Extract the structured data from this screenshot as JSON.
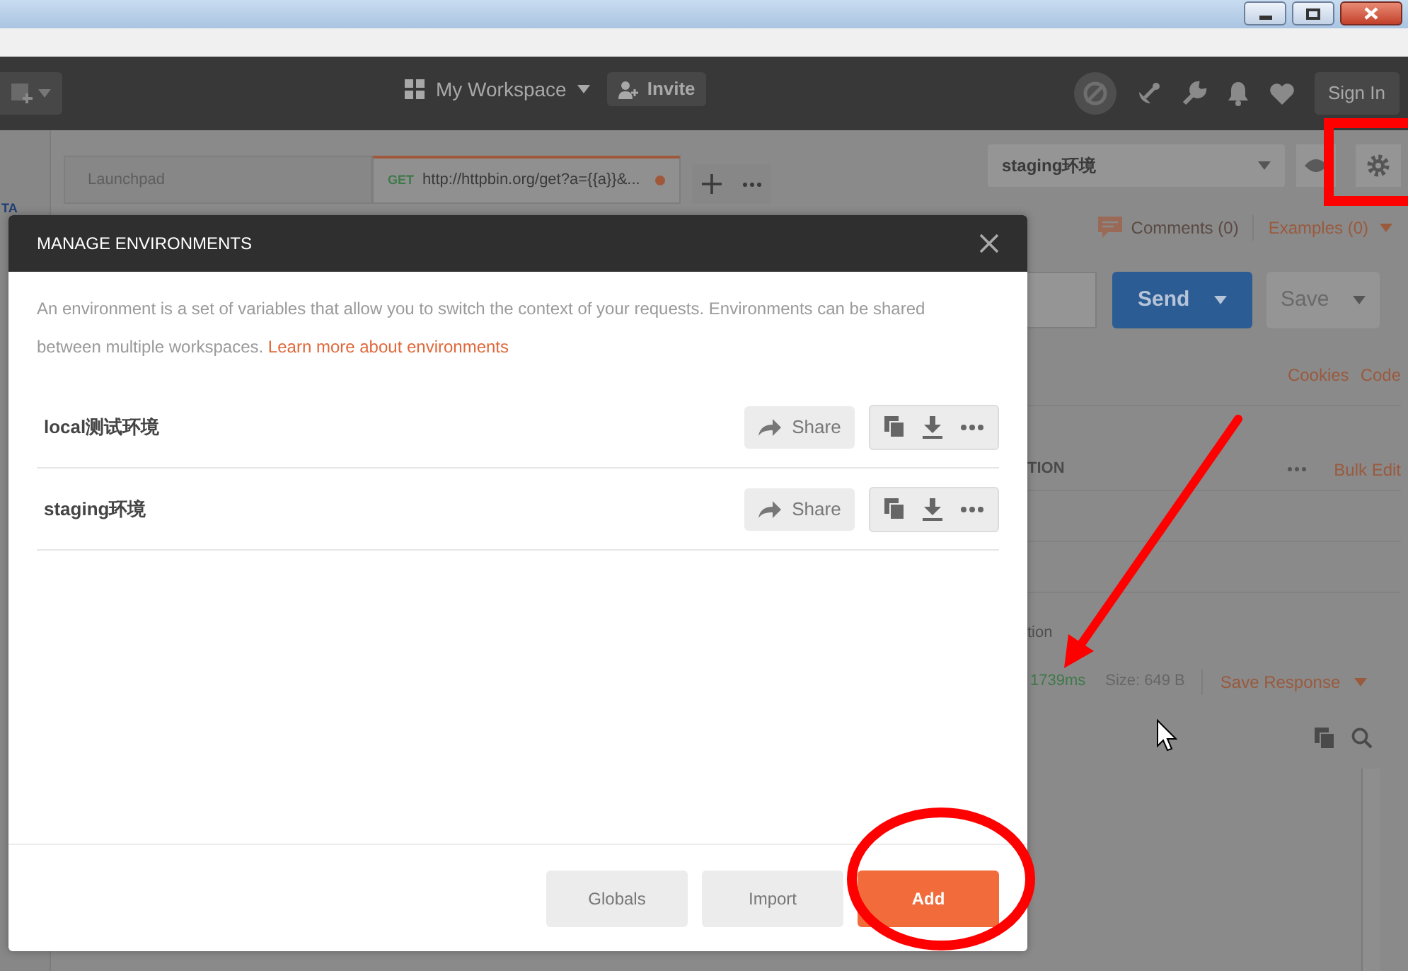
{
  "sidebar_fragment": "TA",
  "header": {
    "workspace": "My Workspace",
    "invite": "Invite",
    "sign_in": "Sign In"
  },
  "tabs": [
    {
      "label": "Launchpad",
      "selected": false
    },
    {
      "method": "GET",
      "label": "http://httpbin.org/get?a={{a}}&...",
      "selected": true,
      "unsaved": true
    }
  ],
  "environment_select": {
    "value": "staging环境"
  },
  "request": {
    "comments": "Comments (0)",
    "examples": "Examples (0)",
    "send": "Send",
    "save": "Save",
    "cookies": "Cookies",
    "code": "Code",
    "column_header": "TION",
    "bulk_edit": "Bulk Edit",
    "partial_text": "tion",
    "time": "1739ms",
    "size": "Size: 649 B",
    "save_response": "Save Response"
  },
  "modal": {
    "title": "MANAGE ENVIRONMENTS",
    "description": "An environment is a set of variables that allow you to switch the context of your requests. Environments can be shared between multiple workspaces.",
    "learn_more": "Learn more about environments",
    "environments": [
      {
        "name": "local测试环境",
        "share": "Share"
      },
      {
        "name": "staging环境",
        "share": "Share"
      }
    ],
    "buttons": [
      {
        "label": "Globals",
        "kind": "secondary"
      },
      {
        "label": "Import",
        "kind": "secondary"
      },
      {
        "label": "Add",
        "kind": "primary"
      }
    ]
  }
}
